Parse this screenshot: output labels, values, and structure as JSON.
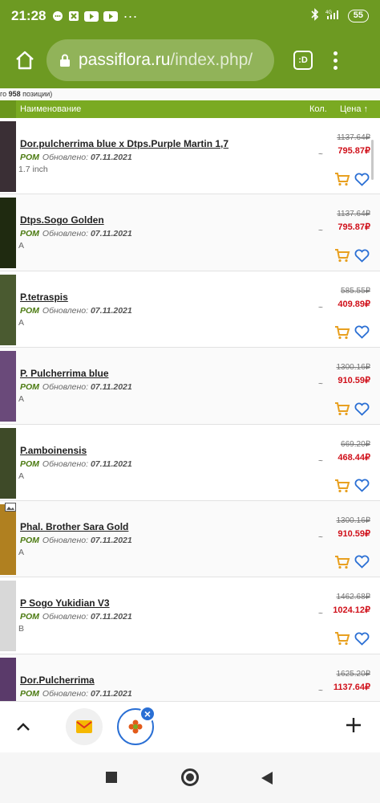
{
  "status": {
    "time": "21:28",
    "battery": "55",
    "signal": "4G"
  },
  "browser": {
    "url_host": "passiflora.ru",
    "url_path": "/index.php/",
    "tabs_label": ":D"
  },
  "catalog": {
    "total_prefix": "го",
    "total_count": "958",
    "total_suffix": "позиции)",
    "columns": {
      "name": "Наименование",
      "qty": "Кол.",
      "price": "Цена ↑"
    },
    "items": [
      {
        "name": "Dor.pulcherrima blue x Dtps.Purple Martin 1,7",
        "vendor": "POM",
        "updated_label": "Обновлено:",
        "date": "07.11.2021",
        "size": "1.7 inch",
        "qty": "~",
        "old_price": "1137.64₽",
        "new_price": "795.87₽"
      },
      {
        "name": "Dtps.Sogo Golden",
        "vendor": "POM",
        "updated_label": "Обновлено:",
        "date": "07.11.2021",
        "size": "A",
        "qty": "~",
        "old_price": "1137.64₽",
        "new_price": "795.87₽"
      },
      {
        "name": "P.tetraspis",
        "vendor": "POM",
        "updated_label": "Обновлено:",
        "date": "07.11.2021",
        "size": "A",
        "qty": "~",
        "old_price": "585.55₽",
        "new_price": "409.89₽"
      },
      {
        "name": "P. Pulcherrima blue",
        "vendor": "POM",
        "updated_label": "Обновлено:",
        "date": "07.11.2021",
        "size": "A",
        "qty": "~",
        "old_price": "1300.16₽",
        "new_price": "910.59₽"
      },
      {
        "name": "P.amboinensis",
        "vendor": "POM",
        "updated_label": "Обновлено:",
        "date": "07.11.2021",
        "size": "A",
        "qty": "~",
        "old_price": "669.20₽",
        "new_price": "468.44₽"
      },
      {
        "name": "Phal. Brother Sara Gold",
        "vendor": "POM",
        "updated_label": "Обновлено:",
        "date": "07.11.2021",
        "size": "A",
        "qty": "~",
        "old_price": "1300.16₽",
        "new_price": "910.59₽"
      },
      {
        "name": "P Sogo Yukidian V3",
        "vendor": "POM",
        "updated_label": "Обновлено:",
        "date": "07.11.2021",
        "size": "B",
        "qty": "~",
        "old_price": "1462.68₽",
        "new_price": "1024.12₽"
      },
      {
        "name": "Dor.Pulcherrima",
        "vendor": "POM",
        "updated_label": "Обновлено:",
        "date": "07.11.2021",
        "size": "",
        "qty": "~",
        "old_price": "1625.20₽",
        "new_price": "1137.64₽"
      }
    ]
  },
  "colors": {
    "accent": "#6d9a22",
    "header": "#7aaa22",
    "price": "#d0101a",
    "cart": "#e8a020",
    "heart": "#2a6fd4"
  }
}
